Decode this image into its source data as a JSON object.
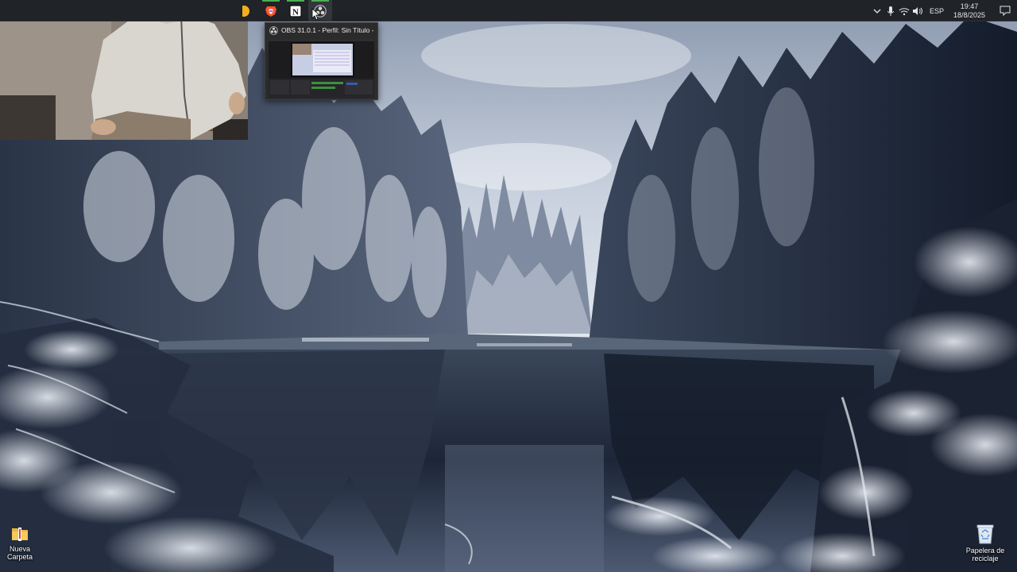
{
  "taskbar": {
    "apps": [
      {
        "name": "brave",
        "icon": "brave-lion-icon"
      },
      {
        "name": "notion",
        "icon": "notion-n-icon",
        "glyph": "N"
      },
      {
        "name": "obs",
        "icon": "obs-studio-icon",
        "active": true
      }
    ],
    "tray": {
      "language": "ESP",
      "time": "19:47",
      "date": "18/8/2025",
      "icons": [
        "chevron-up-icon",
        "microphone-icon",
        "wifi-icon",
        "volume-icon",
        "notification-icon"
      ]
    },
    "accent_color": "#4caf50"
  },
  "obs_preview": {
    "title": "OBS 31.0.1 - Perfil: Sin Título - E...",
    "icon": "obs-studio-icon"
  },
  "desktop": {
    "icons": [
      {
        "id": "folder",
        "line1": "Nueva",
        "line2": "Carpeta",
        "icon": "folder-icon"
      },
      {
        "id": "recycle",
        "line1": "Papelera de",
        "line2": "reciclaje",
        "icon": "recycle-bin-icon"
      }
    ]
  },
  "colors": {
    "taskbar_bg": "#202327",
    "sky": "#c6cfdb",
    "water": "#1b2333",
    "trees": "#1c2638"
  }
}
